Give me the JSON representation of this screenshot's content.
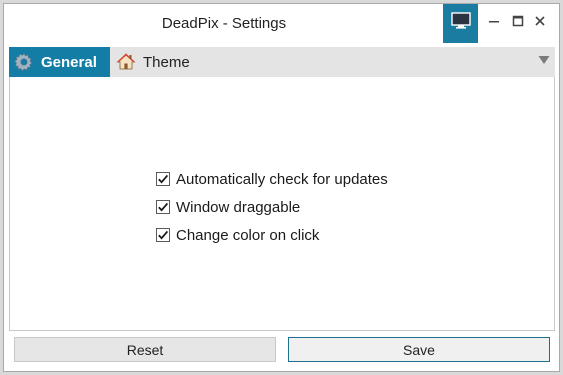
{
  "window": {
    "title": "DeadPix - Settings",
    "accent_color": "#147da6",
    "controls": {
      "monitor_icon": "monitor-icon",
      "minimize_icon": "minimize-icon",
      "maximize_icon": "maximize-icon",
      "close_icon": "close-icon"
    }
  },
  "tabs": [
    {
      "label": "General",
      "icon": "gear-icon",
      "active": true
    },
    {
      "label": "Theme",
      "icon": "home-icon",
      "active": false
    }
  ],
  "tab_dropdown_icon": "triangle-down-icon",
  "settings": [
    {
      "label": "Automatically check for updates",
      "checked": true
    },
    {
      "label": "Window draggable",
      "checked": true
    },
    {
      "label": "Change color on click",
      "checked": true
    }
  ],
  "buttons": {
    "reset_label": "Reset",
    "save_label": "Save"
  }
}
